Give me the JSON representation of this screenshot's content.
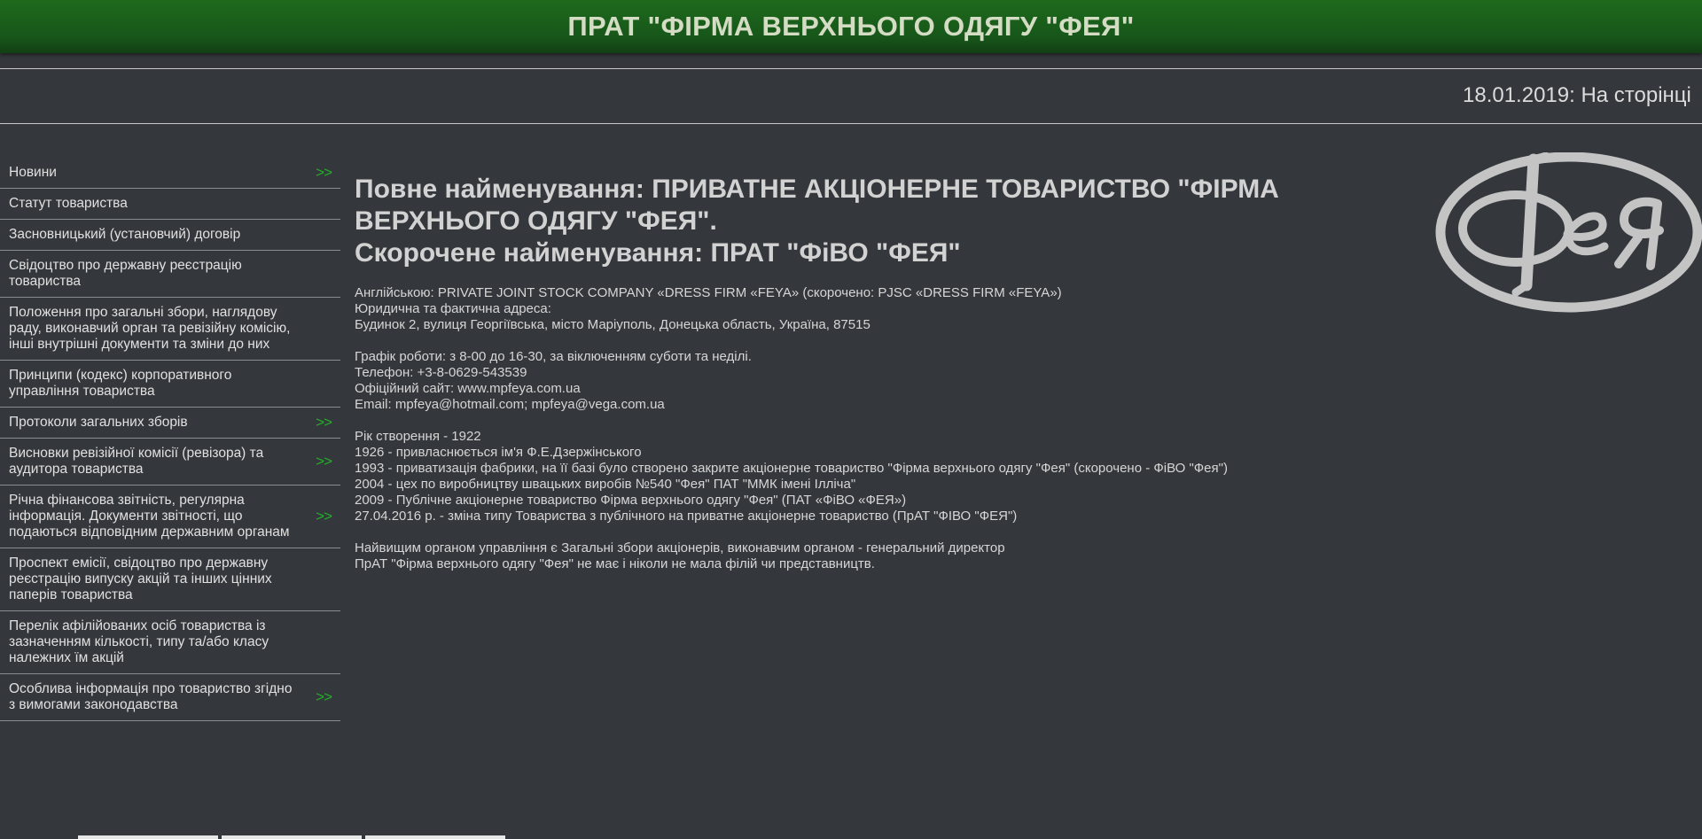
{
  "header": {
    "title": "ПРАТ \"ФІРМА ВЕРХНЬОГО ОДЯГУ \"ФЕЯ\""
  },
  "ticker": {
    "text": "18.01.2019: На сторінці"
  },
  "sidebar": {
    "arrow_symbol": ">>",
    "items": [
      {
        "label": "Новини",
        "has_arrow": true
      },
      {
        "label": "Статут товариства",
        "has_arrow": false
      },
      {
        "label": "Засновницький (установчий) договір",
        "has_arrow": false
      },
      {
        "label": "Свідоцтво про державну реєстрацію товариства",
        "has_arrow": false
      },
      {
        "label": "Положення про загальні збори, наглядову раду, виконавчий орган та ревізійну комісію, інші внутрішні документи та зміни до них",
        "has_arrow": false
      },
      {
        "label": "Принципи (кодекс) корпоративного управління товариства",
        "has_arrow": false
      },
      {
        "label": "Протоколи загальних зборів",
        "has_arrow": true
      },
      {
        "label": "Висновки ревізійної комісії (ревізора) та аудитора товариства",
        "has_arrow": true
      },
      {
        "label": "Річна фінансова звітність, регулярна інформація. Документи звітності, що подаються відповідним державним органам",
        "has_arrow": true
      },
      {
        "label": "Проспект емісії, свідоцтво про державну реєстрацію випуску акцій та інших цінних паперів товариства",
        "has_arrow": false
      },
      {
        "label": "Перелік афілійованих осіб товариства із зазначенням кількості, типу та/або класу належних їм акцій",
        "has_arrow": false
      },
      {
        "label": "Особлива інформація про товариство згідно з вимогами законодавства",
        "has_arrow": true
      }
    ]
  },
  "main": {
    "heading_line1": "Повне найменування: ПРИВАТНЕ АКЦІОНЕРНЕ ТОВАРИСТВО \"ФІРМА ВЕРХНЬОГО ОДЯГУ \"ФЕЯ\".",
    "heading_line2": "Скорочене найменування: ПРАТ \"ФіВО \"ФЕЯ\"",
    "english_name": "Англійською: PRIVATE JOINT STOCK COMPANY «DRESS FIRM «FEYA» (скорочено: PJSC «DRESS FIRM «FEYA»)",
    "address_label": "Юридична та фактична адреса:",
    "address": "Будинок 2, вулиця Георгіївська, місто Маріуполь, Донецька область, Україна, 87515",
    "schedule": "Графік роботи: з 8-00 до 16-30, за віключенням суботи та неділі.",
    "phone": "Телефон: +3-8-0629-543539",
    "website": "Офіційний сайт: www.mpfeya.com.ua",
    "email": "Email: mpfeya@hotmail.com; mpfeya@vega.com.ua",
    "history": [
      "Рік створення - 1922",
      "1926 - привласнюється ім'я Ф.Е.Дзержінського",
      "1993 - приватизація фабрики, на її базі було створено закрите акціонерне товариство \"Фірма верхнього одягу \"Фея\" (скорочено - ФіВО \"Фея\")",
      "2004 - цех по виробництву швацьких виробів №540 \"Фея\" ПАТ \"ММК імені Ілліча\"",
      "2009 - Публічне акціонерне товариство Фірма верхнього одягу \"Фея\" (ПАТ «ФіВО «ФЕЯ»)",
      "27.04.2016 р. - зміна типу Товариства з публічного на приватне акціонерне товариство (ПрАТ \"ФІВО \"ФЕЯ\")"
    ],
    "governance": "Найвищим органом управління є Загальні збори акціонерів, виконавчим органом - генеральний директор",
    "branches": "ПрАТ \"Фірма верхнього одягу \"Фея\" не має і ніколи не мала філій чи представництв."
  },
  "logo": {
    "icon": "feya-logo-icon",
    "text": "Фея",
    "color": "#c4c4c4"
  },
  "colors": {
    "header_bg": "#17561a",
    "page_bg": "#34373b",
    "arrow": "#23b02b"
  }
}
